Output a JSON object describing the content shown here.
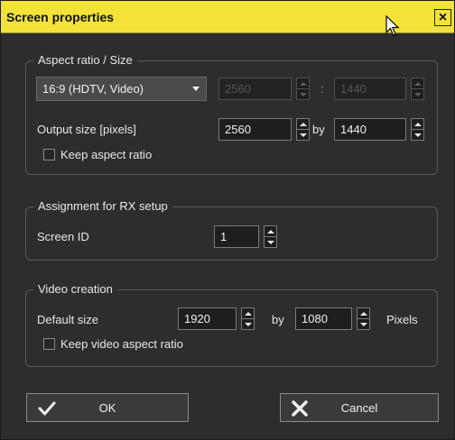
{
  "dialog": {
    "title": "Screen properties",
    "close_glyph": "×"
  },
  "aspect": {
    "legend": "Aspect ratio / Size",
    "ratio_select": "16:9 (HDTV, Video)",
    "ratio_width": "2560",
    "ratio_sep": ":",
    "ratio_height": "1440",
    "output_label": "Output size [pixels]",
    "output_width": "2560",
    "by_label": "by",
    "output_height": "1440",
    "keep_aspect_label": "Keep aspect ratio",
    "keep_aspect_checked": false
  },
  "rx": {
    "legend": "Assignment for RX setup",
    "screen_id_label": "Screen ID",
    "screen_id": "1"
  },
  "video": {
    "legend": "Video creation",
    "default_size_label": "Default size",
    "width": "1920",
    "by_label": "by",
    "height": "1080",
    "unit": "Pixels",
    "keep_aspect_label": "Keep video aspect ratio",
    "keep_aspect_checked": false
  },
  "buttons": {
    "ok": "OK",
    "cancel": "Cancel"
  },
  "colors": {
    "titlebar": "#f2e23a",
    "background": "#2d2d2d"
  },
  "icons": {
    "close": "close-icon",
    "cursor": "mouse-pointer-icon",
    "ok": "checkmark-icon",
    "cancel": "x-icon"
  }
}
